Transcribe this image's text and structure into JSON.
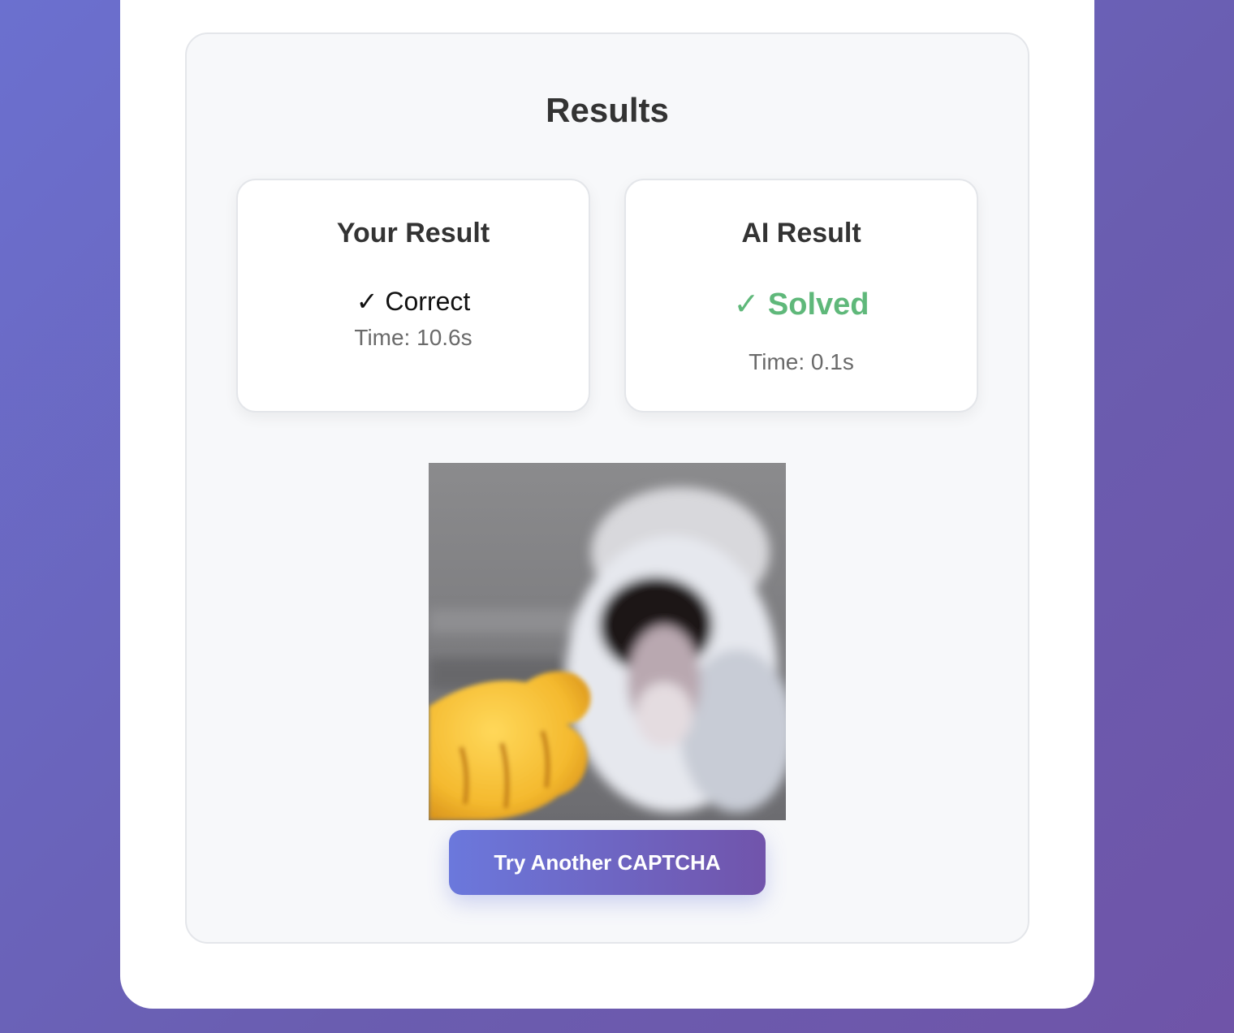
{
  "results": {
    "title": "Results",
    "your_result": {
      "title": "Your Result",
      "status": "✓ Correct",
      "time": "Time: 10.6s"
    },
    "ai_result": {
      "title": "AI Result",
      "status": "✓ Solved",
      "time": "Time: 0.1s",
      "status_color": "#5fb87a"
    }
  },
  "actions": {
    "try_another_label": "Try Another CAPTCHA"
  },
  "colors": {
    "background_gradient_start": "#6b70cf",
    "background_gradient_end": "#6f54a8",
    "button_gradient_start": "#6b78dc",
    "button_gradient_end": "#7154ab"
  }
}
